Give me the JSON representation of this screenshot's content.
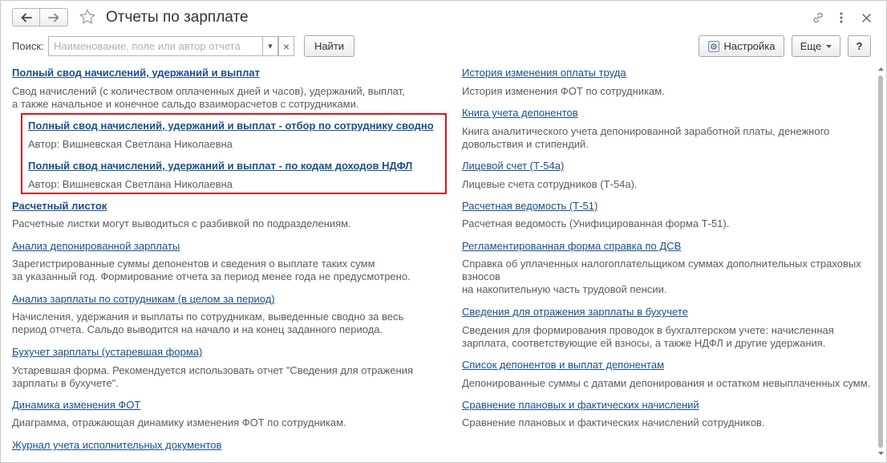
{
  "header": {
    "title": "Отчеты по зарплате",
    "back_icon": "arrow-left-icon",
    "forward_icon": "arrow-right-icon",
    "favorite_icon": "star-icon",
    "link_icon": "link-icon",
    "more_icon": "more-vertical-icon",
    "close_icon": "close-icon"
  },
  "search": {
    "label": "Поиск:",
    "placeholder": "Наименование, поле или автор отчета",
    "value": "",
    "dropdown_glyph": "▾",
    "clear_glyph": "×",
    "find_label": "Найти"
  },
  "toolbar": {
    "settings_label": "Настройка",
    "more_label": "Еще",
    "help_label": "?"
  },
  "colors": {
    "link": "#1a4f8c",
    "description": "#5c5c5c",
    "highlight_border": "#d9151a"
  },
  "left": {
    "r1": {
      "title": "Полный свод начислений, удержаний и выплат",
      "desc1": "Свод начислений (с количеством оплаченных дней и часов), удержаний, выплат,",
      "desc2": "а также начальное и конечное сальдо взаиморасчетов с сотрудниками."
    },
    "r1a": {
      "title": "Полный свод начислений, удержаний и выплат - отбор по сотруднику сводно",
      "author": "Автор: Вишневская Светлана Николаевна"
    },
    "r1b": {
      "title": "Полный свод начислений, удержаний и выплат - по кодам доходов НДФЛ",
      "author": "Автор: Вишневская Светлана Николаевна"
    },
    "r2": {
      "title": "Расчетный листок",
      "desc1": "Расчетные листки могут выводиться с разбивкой по подразделениям."
    },
    "r3": {
      "title": "Анализ депонированной зарплаты",
      "desc1": "Зарегистрированные суммы депонентов и сведения о выплате таких сумм",
      "desc2": "за указанный год. Формирование отчета за период менее года не предусмотрено."
    },
    "r4": {
      "title": "Анализ зарплаты по сотрудникам (в целом за период)",
      "desc1": "Начисления, удержания и выплаты по сотрудникам, выведенные сводно за весь",
      "desc2": "период отчета. Сальдо выводится на начало и на конец заданного периода."
    },
    "r5": {
      "title": "Бухучет зарплаты (устаревшая форма)",
      "desc1": "Устаревшая форма. Рекомендуется использовать отчет \"Сведения для отражения",
      "desc2": "зарплаты в бухучете\"."
    },
    "r6": {
      "title": "Динамика изменения ФОТ",
      "desc1": "Диаграмма, отражающая динамику изменения ФОТ по сотрудникам."
    },
    "r7": {
      "title": "Журнал учета исполнительных документов"
    }
  },
  "right": {
    "r1": {
      "title": "История изменения оплаты труда",
      "desc1": "История изменения ФОТ по сотрудникам."
    },
    "r2": {
      "title": "Книга учета депонентов",
      "desc1": "Книга аналитического учета депонированной заработной платы, денежного",
      "desc2": "довольствия и стипендий."
    },
    "r3": {
      "title": "Лицевой счет (Т-54а)",
      "desc1": "Лицевые счета сотрудников (Т-54а)."
    },
    "r4": {
      "title": "Расчетная ведомость (Т-51)",
      "desc1": "Расчетная ведомость (Унифицированная форма Т-51)."
    },
    "r5": {
      "title": "Регламентированная форма справка по ДСВ",
      "desc1": "Справка об уплаченных налогоплательщиком суммах дополнительных страховых",
      "desc2": "взносов",
      "desc3": "на накопительную часть трудовой пенсии."
    },
    "r6": {
      "title": "Сведения для отражения зарплаты в бухучете",
      "desc1": "Сведения для формирования проводок в бухгалтерском учете: начисленная",
      "desc2": "зарплата, соответствующие ей взносы, а также НДФЛ и другие удержания."
    },
    "r7": {
      "title": "Список депонентов и выплат депонентам",
      "desc1": "Депонированные суммы с датами депонирования и остатком невыплаченных сумм."
    },
    "r8": {
      "title": "Сравнение плановых и фактических начислений",
      "desc1": "Сравнение плановых и фактических начислений сотрудников."
    }
  }
}
